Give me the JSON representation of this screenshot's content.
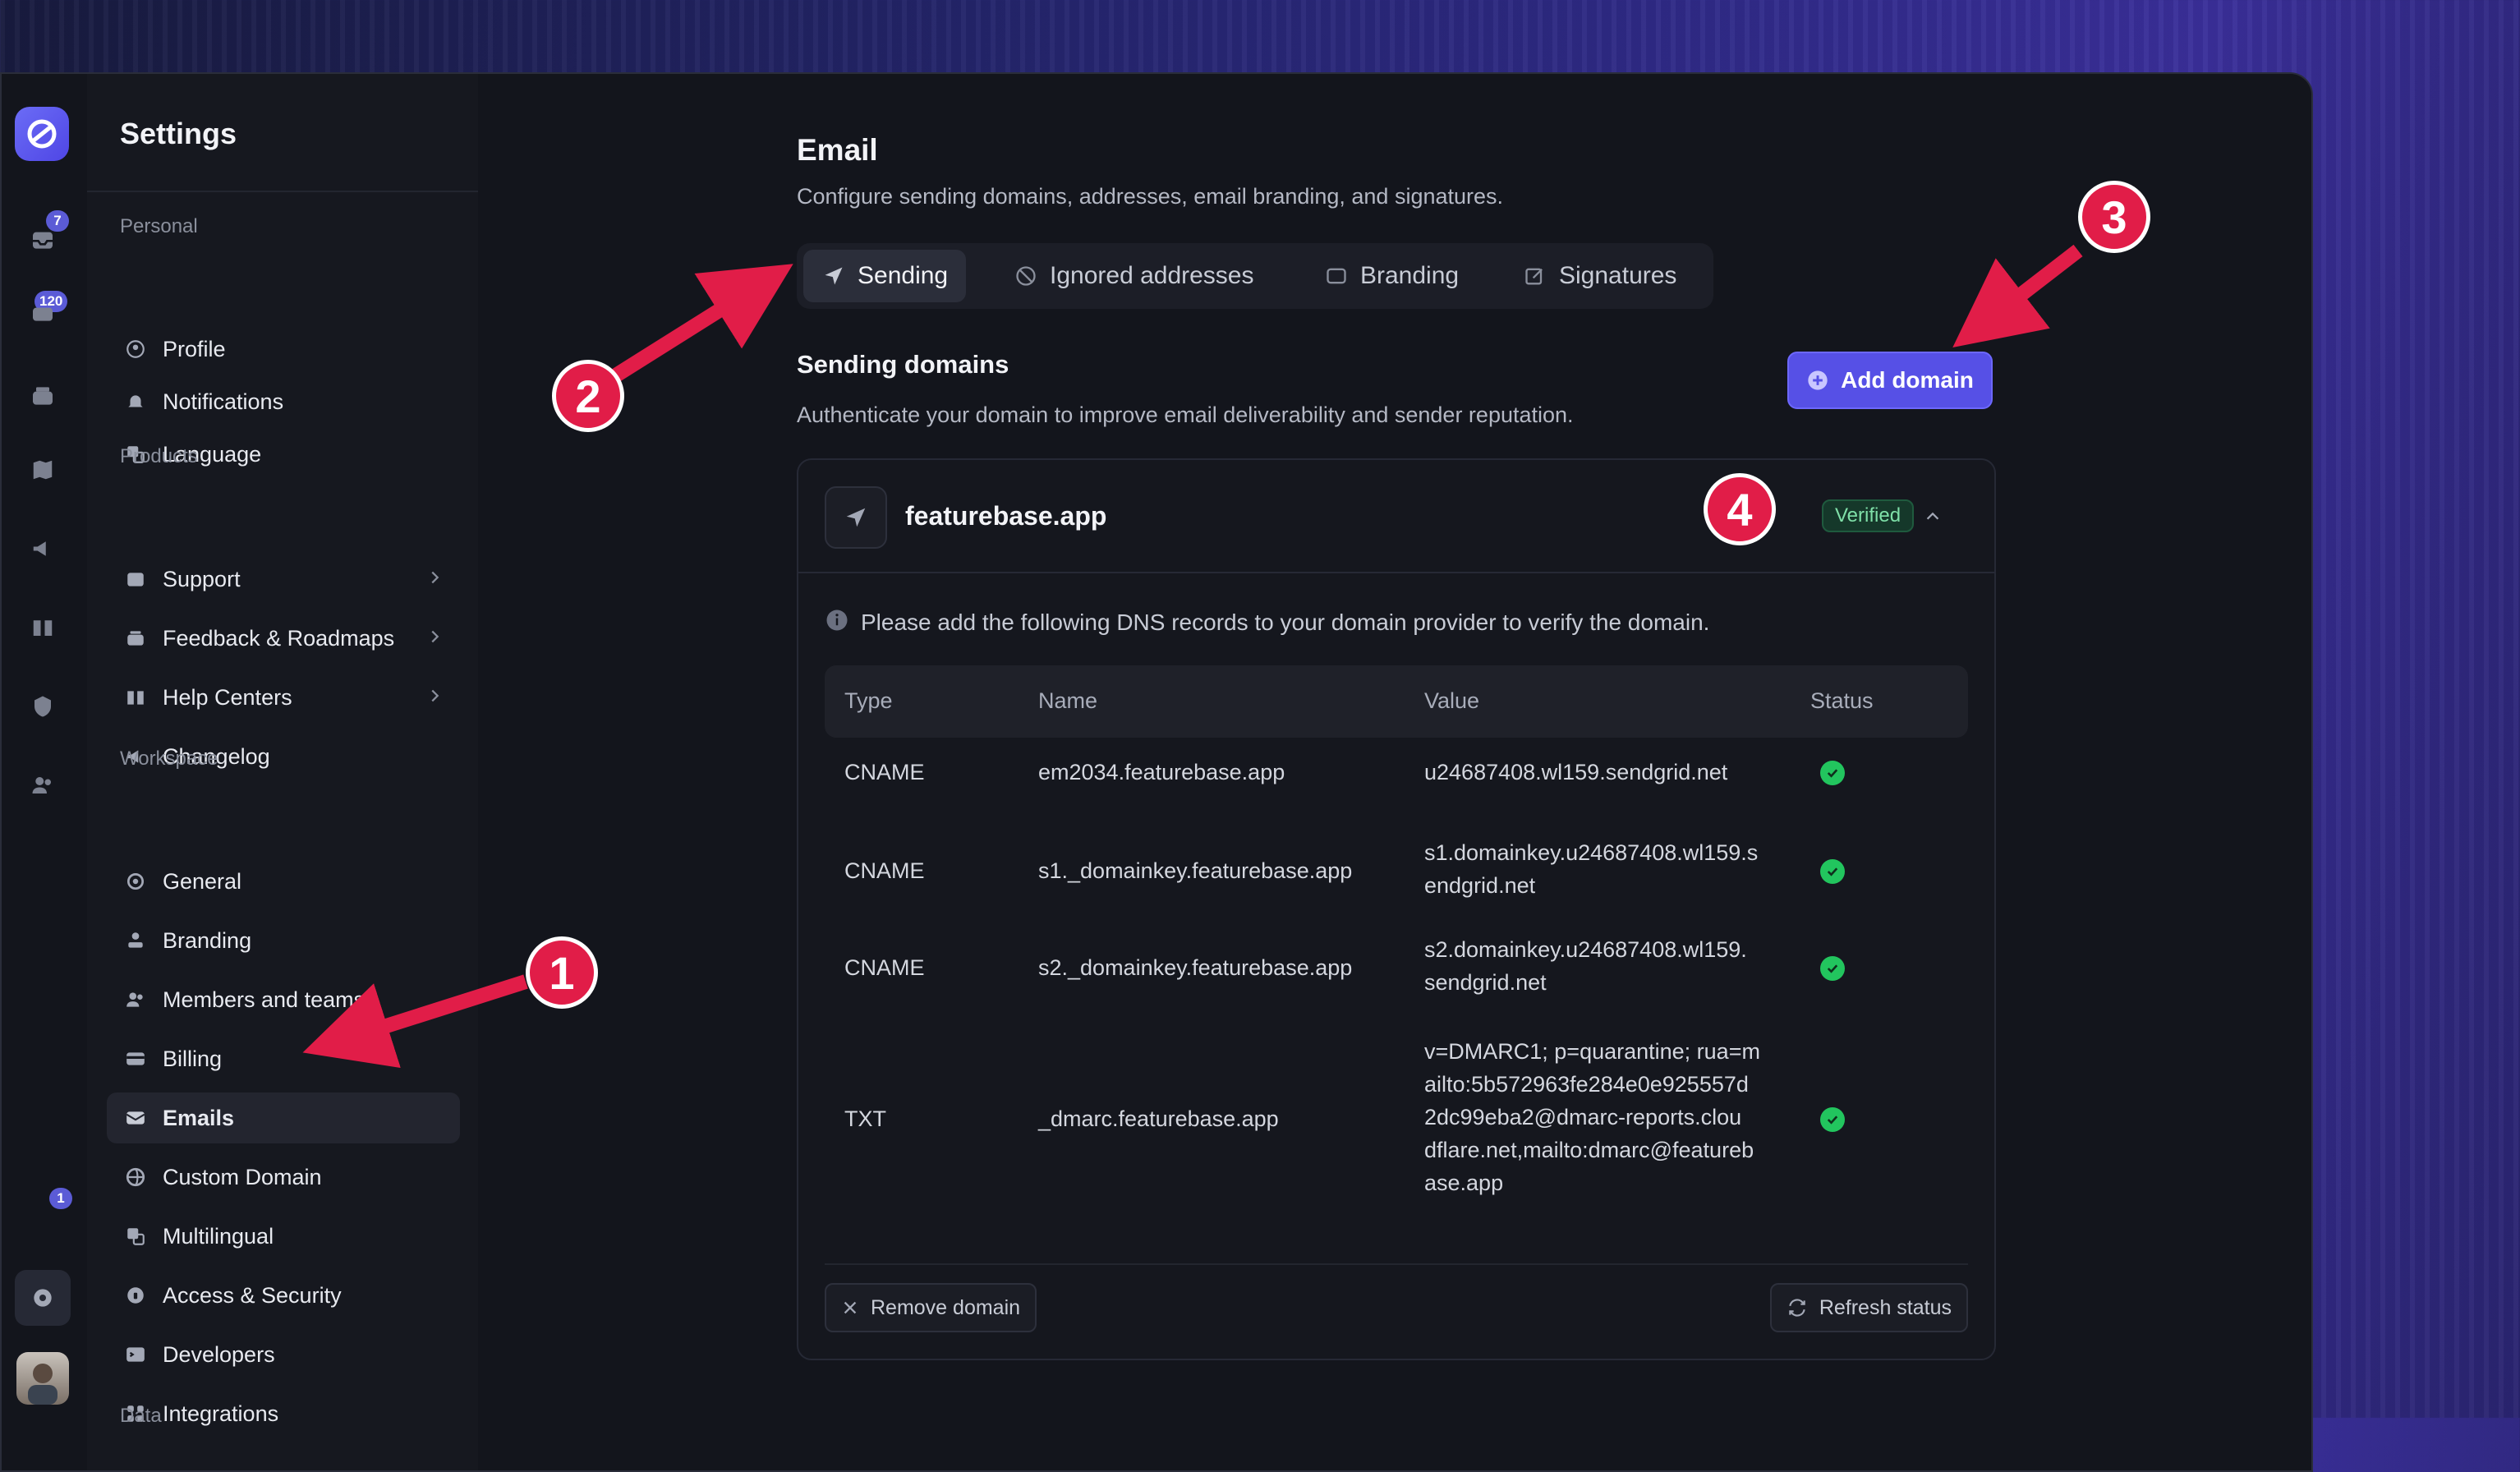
{
  "rail": {
    "inbox_badge": "7",
    "tickets_badge": "120",
    "notifications_badge": "1"
  },
  "sidebar": {
    "title": "Settings",
    "sections": {
      "personal": "Personal",
      "products": "Products",
      "workspace": "Workspace",
      "data": "Data"
    },
    "personal_items": [
      "Profile",
      "Notifications",
      "Language"
    ],
    "product_items": [
      "Support",
      "Feedback & Roadmaps",
      "Help Centers",
      "Changelog"
    ],
    "workspace_items": [
      "General",
      "Branding",
      "Members and teams",
      "Billing",
      "Emails",
      "Custom Domain",
      "Multilingual",
      "Access & Security",
      "Developers",
      "Integrations"
    ],
    "active_item": "Emails"
  },
  "page": {
    "title": "Email",
    "subtitle": "Configure sending domains, addresses, email branding, and signatures.",
    "tabs": [
      "Sending",
      "Ignored addresses",
      "Branding",
      "Signatures"
    ],
    "active_tab": "Sending"
  },
  "sending": {
    "title": "Sending domains",
    "subtitle": "Authenticate your domain to improve email deliverability and sender reputation.",
    "add_button": "Add domain"
  },
  "domain": {
    "name": "featurebase.app",
    "status": "Verified",
    "info": "Please add the following DNS records to your domain provider to verify the domain.",
    "columns": [
      "Type",
      "Name",
      "Value",
      "Status"
    ],
    "records": [
      {
        "type": "CNAME",
        "name": "em2034.featurebase.app",
        "value": [
          "u24687408.wl159.sendgrid.net"
        ],
        "status": "ok"
      },
      {
        "type": "CNAME",
        "name": "s1._domainkey.featurebase.app",
        "value": [
          "s1.domainkey.u24687408.wl159.s",
          "endgrid.net"
        ],
        "status": "ok"
      },
      {
        "type": "CNAME",
        "name": "s2._domainkey.featurebase.app",
        "value": [
          "s2.domainkey.u24687408.wl159.",
          "sendgrid.net"
        ],
        "status": "ok"
      },
      {
        "type": "TXT",
        "name": "_dmarc.featurebase.app",
        "value": [
          "v=DMARC1; p=quarantine; rua=m",
          "ailto:5b572963fe284e0e925557d",
          "2dc99eba2@dmarc-reports.clou",
          "dflare.net,mailto:dmarc@featureb",
          "ase.app"
        ],
        "status": "ok"
      }
    ],
    "remove_button": "Remove domain",
    "refresh_button": "Refresh status"
  },
  "annotations": [
    "1",
    "2",
    "3",
    "4"
  ],
  "colors": {
    "accent": "#5650e6",
    "marker": "#e11d48",
    "verified_text": "#7fe0a8",
    "status_ok": "#22c55e"
  }
}
